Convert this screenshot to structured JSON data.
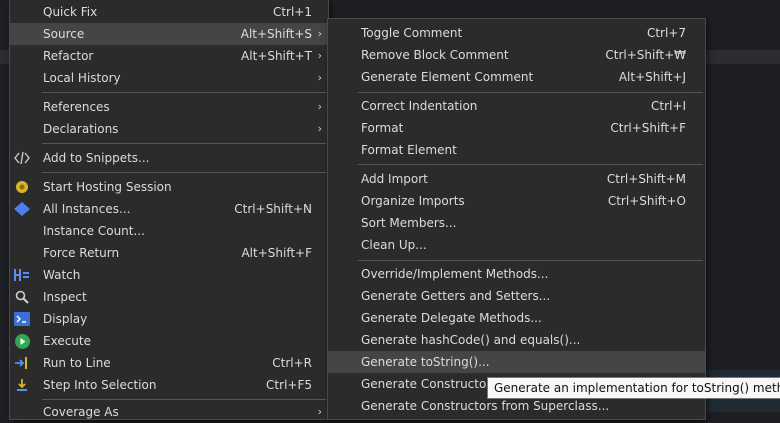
{
  "context_menu": {
    "items": [
      {
        "label": "Quick Fix",
        "accel": "Ctrl+1"
      },
      {
        "label": "Source",
        "accel": "Alt+Shift+S",
        "submenu": true
      },
      {
        "label": "Refactor",
        "accel": "Alt+Shift+T",
        "submenu": true
      },
      {
        "label": "Local History",
        "accel": "",
        "submenu": true
      },
      {
        "label": "References",
        "accel": "",
        "submenu": true
      },
      {
        "label": "Declarations",
        "accel": "",
        "submenu": true
      },
      {
        "label": "Add to Snippets...",
        "accel": ""
      },
      {
        "label": "Start Hosting Session",
        "accel": ""
      },
      {
        "label": "All Instances...",
        "accel": "Ctrl+Shift+N"
      },
      {
        "label": "Instance Count...",
        "accel": ""
      },
      {
        "label": "Force Return",
        "accel": "Alt+Shift+F"
      },
      {
        "label": "Watch",
        "accel": ""
      },
      {
        "label": "Inspect",
        "accel": ""
      },
      {
        "label": "Display",
        "accel": ""
      },
      {
        "label": "Execute",
        "accel": ""
      },
      {
        "label": "Run to Line",
        "accel": "Ctrl+R"
      },
      {
        "label": "Step Into Selection",
        "accel": "Ctrl+F5"
      },
      {
        "label": "Coverage As",
        "accel": "",
        "submenu": true
      }
    ],
    "arrow_glyph": "›"
  },
  "source_submenu": {
    "items": [
      {
        "label": "Toggle Comment",
        "accel": "Ctrl+7"
      },
      {
        "label": "Remove Block Comment",
        "accel": "Ctrl+Shift+₩"
      },
      {
        "label": "Generate Element Comment",
        "accel": "Alt+Shift+J"
      },
      {
        "label": "Correct Indentation",
        "accel": "Ctrl+I"
      },
      {
        "label": "Format",
        "accel": "Ctrl+Shift+F"
      },
      {
        "label": "Format Element",
        "accel": ""
      },
      {
        "label": "Add Import",
        "accel": "Ctrl+Shift+M"
      },
      {
        "label": "Organize Imports",
        "accel": "Ctrl+Shift+O"
      },
      {
        "label": "Sort Members...",
        "accel": ""
      },
      {
        "label": "Clean Up...",
        "accel": ""
      },
      {
        "label": "Override/Implement Methods...",
        "accel": ""
      },
      {
        "label": "Generate Getters and Setters...",
        "accel": ""
      },
      {
        "label": "Generate Delegate Methods...",
        "accel": ""
      },
      {
        "label": "Generate hashCode() and equals()...",
        "accel": ""
      },
      {
        "label": "Generate toString()...",
        "accel": ""
      },
      {
        "label": "Generate Constructor u",
        "accel": ""
      },
      {
        "label": "Generate Constructors from Superclass...",
        "accel": ""
      }
    ]
  },
  "tooltip": {
    "text": "Generate an implementation for toString() method"
  },
  "icons": {
    "snippets": "code-brackets-icon",
    "hosting": "hosting-session-icon",
    "instances": "diamond-icon",
    "watch": "watch-icon",
    "inspect": "magnifier-icon",
    "display": "display-console-icon",
    "execute": "execute-play-icon",
    "run_to_line": "run-to-line-icon",
    "step_into": "step-into-icon"
  },
  "colors": {
    "menu_bg": "#2b2b2b",
    "highlight": "#454545",
    "tooltip_bg": "#f7f7f7"
  }
}
